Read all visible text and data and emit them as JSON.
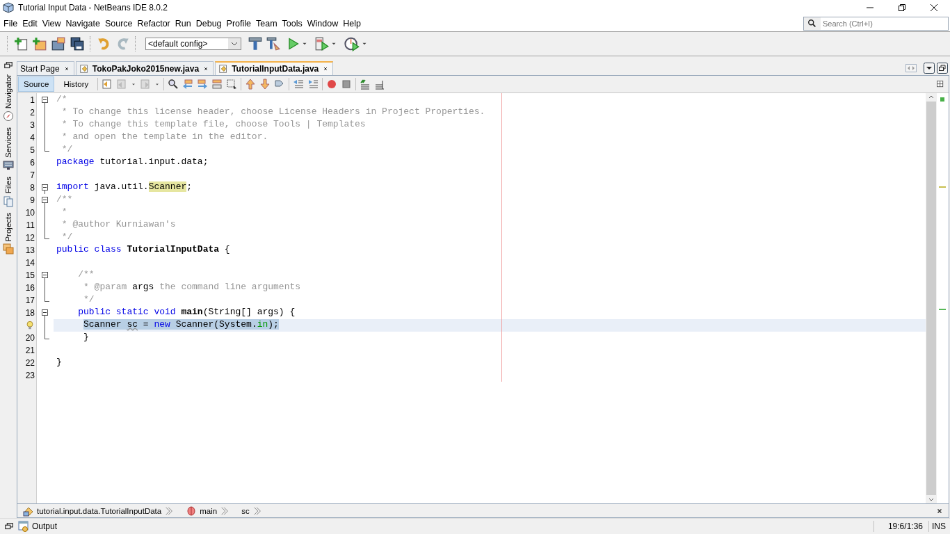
{
  "window": {
    "title": "Tutorial Input Data - NetBeans IDE 8.0.2"
  },
  "menu": [
    "File",
    "Edit",
    "View",
    "Navigate",
    "Source",
    "Refactor",
    "Run",
    "Debug",
    "Profile",
    "Team",
    "Tools",
    "Window",
    "Help"
  ],
  "search": {
    "placeholder": "Search (Ctrl+I)"
  },
  "toolbar": {
    "config": "<default config>"
  },
  "side_tabs": [
    {
      "label": "Navigator",
      "kind": "compass"
    },
    {
      "label": "Services",
      "kind": "server"
    },
    {
      "label": "Files",
      "kind": "files"
    },
    {
      "label": "Projects",
      "kind": "projects"
    }
  ],
  "editor_tabs": [
    {
      "label": "Start Page",
      "selected": false,
      "kind": "page"
    },
    {
      "label": "TokoPakJoko2015new.java",
      "selected": false,
      "kind": "java"
    },
    {
      "label": "TutorialInputData.java",
      "selected": true,
      "kind": "java"
    }
  ],
  "view_tabs": [
    {
      "label": "Source",
      "selected": true
    },
    {
      "label": "History",
      "selected": false
    }
  ],
  "code": {
    "lines": [
      {
        "number": "1",
        "kind": "fold-start",
        "current": false,
        "selected": false,
        "tokens": [
          {
            "text": "/*",
            "kind": "comment"
          }
        ]
      },
      {
        "number": "2",
        "kind": "fold-body",
        "current": false,
        "selected": false,
        "tokens": [
          {
            "text": " * To change this license header, choose License Headers in Project Properties.",
            "kind": "comment"
          }
        ]
      },
      {
        "number": "3",
        "kind": "fold-body",
        "current": false,
        "selected": false,
        "tokens": [
          {
            "text": " * To change this template file, choose Tools | Templates",
            "kind": "comment"
          }
        ]
      },
      {
        "number": "4",
        "kind": "fold-body",
        "current": false,
        "selected": false,
        "tokens": [
          {
            "text": " * and open the template in the editor.",
            "kind": "comment"
          }
        ]
      },
      {
        "number": "5",
        "kind": "fold-end",
        "current": false,
        "selected": false,
        "tokens": [
          {
            "text": " */",
            "kind": "comment"
          }
        ]
      },
      {
        "number": "6",
        "kind": "plain",
        "current": false,
        "selected": false,
        "tokens": [
          {
            "text": "package",
            "kind": "keyword"
          },
          {
            "text": " tutorial.input.data;",
            "kind": "plain"
          }
        ]
      },
      {
        "number": "7",
        "kind": "plain",
        "current": false,
        "selected": false
      },
      {
        "number": "8",
        "kind": "fold-start",
        "current": false,
        "selected": false,
        "tokens": [
          {
            "text": "import",
            "kind": "keyword"
          },
          {
            "text": " java.util.",
            "kind": "plain"
          },
          {
            "text": "Scanner",
            "kind": "mark"
          },
          {
            "text": ";",
            "kind": "plain"
          }
        ]
      },
      {
        "number": "9",
        "kind": "fold-start",
        "current": false,
        "selected": false,
        "tokens": [
          {
            "text": "/**",
            "kind": "comment"
          }
        ]
      },
      {
        "number": "10",
        "kind": "fold-body",
        "current": false,
        "selected": false,
        "tokens": [
          {
            "text": " *",
            "kind": "comment"
          }
        ]
      },
      {
        "number": "11",
        "kind": "fold-body",
        "current": false,
        "selected": false,
        "tokens": [
          {
            "text": " * @author Kurniawan's",
            "kind": "comment"
          }
        ]
      },
      {
        "number": "12",
        "kind": "fold-end",
        "current": false,
        "selected": false,
        "tokens": [
          {
            "text": " */",
            "kind": "comment"
          }
        ]
      },
      {
        "number": "13",
        "kind": "plain",
        "current": false,
        "selected": false,
        "tokens": [
          {
            "text": "public class ",
            "kind": "keyword"
          },
          {
            "text": "TutorialInputData",
            "kind": "bold"
          },
          {
            "text": " {",
            "kind": "plain"
          }
        ]
      },
      {
        "number": "14",
        "kind": "plain",
        "current": false,
        "selected": false
      },
      {
        "number": "15",
        "kind": "fold-start",
        "current": false,
        "selected": false,
        "tokens": [
          {
            "text": "    /**",
            "kind": "comment"
          }
        ]
      },
      {
        "number": "16",
        "kind": "fold-body",
        "current": false,
        "selected": false,
        "tokens": [
          {
            "text": "     * @param ",
            "kind": "comment"
          },
          {
            "text": "args",
            "kind": "plain"
          },
          {
            "text": " the command line arguments",
            "kind": "comment"
          }
        ]
      },
      {
        "number": "17",
        "kind": "fold-end",
        "current": false,
        "selected": false,
        "tokens": [
          {
            "text": "     */",
            "kind": "comment"
          }
        ]
      },
      {
        "number": "18",
        "kind": "fold-start",
        "current": false,
        "selected": false,
        "tokens": [
          {
            "text": "    public static void ",
            "kind": "keyword"
          },
          {
            "text": "main",
            "kind": "bold"
          },
          {
            "text": "(String[] args) {",
            "kind": "plain"
          }
        ]
      },
      {
        "hint": true,
        "kind": "fold-body",
        "current": true,
        "selected": true,
        "tokens": [
          {
            "text": "     Scanner ",
            "kind": "plain"
          },
          {
            "text": "sc",
            "kind": "unused"
          },
          {
            "text": " = ",
            "kind": "plain"
          },
          {
            "text": "new",
            "kind": "keyword"
          },
          {
            "text": " Scanner(System.",
            "kind": "plain"
          },
          {
            "text": "in",
            "kind": "field"
          },
          {
            "text": ");",
            "kind": "plain"
          }
        ]
      },
      {
        "number": "20",
        "kind": "fold-end",
        "current": false,
        "selected": false,
        "tokens": [
          {
            "text": "     }",
            "kind": "plain"
          }
        ]
      },
      {
        "number": "21",
        "kind": "plain",
        "current": false,
        "selected": false
      },
      {
        "number": "22",
        "kind": "plain",
        "current": false,
        "selected": false,
        "tokens": [
          {
            "text": "}",
            "kind": "plain"
          }
        ]
      },
      {
        "number": "23",
        "kind": "plain",
        "current": false,
        "selected": false
      }
    ]
  },
  "breadcrumb": [
    {
      "label": "tutorial.input.data.TutorialInputData",
      "kind": "class"
    },
    {
      "label": "main",
      "kind": "method"
    },
    {
      "label": "sc",
      "kind": "variable"
    }
  ],
  "output": {
    "label": "Output"
  },
  "status": {
    "position": "19:6/1:36",
    "mode": "INS"
  }
}
